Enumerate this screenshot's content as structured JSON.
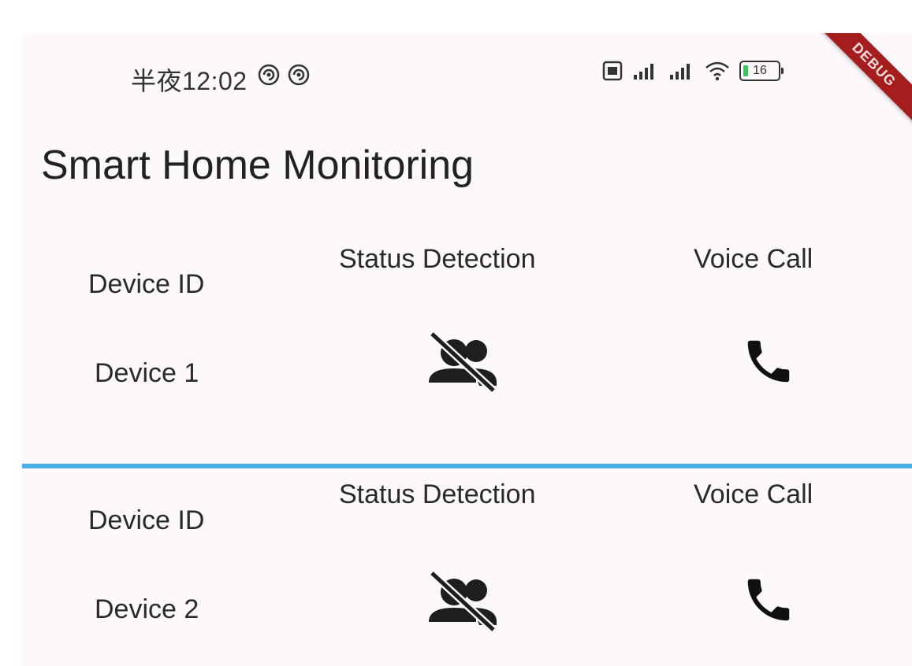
{
  "status_bar": {
    "time": "半夜12:02",
    "battery_level": "16",
    "debug_banner": "DEBUG"
  },
  "app": {
    "title": "Smart Home Monitoring"
  },
  "devices": [
    {
      "id_header": "Device ID",
      "status_header": "Status Detection",
      "voice_header": "Voice Call",
      "name": "Device 1",
      "status_icon": "person-off-icon",
      "call_icon": "phone-icon"
    },
    {
      "id_header": "Device ID",
      "status_header": "Status Detection",
      "voice_header": "Voice Call",
      "name": "Device 2",
      "status_icon": "person-off-icon",
      "call_icon": "phone-icon"
    }
  ],
  "colors": {
    "background": "#fcf8fc",
    "divider": "#47aee9",
    "debug_banner": "#a51d1d",
    "text": "#2a2a2a"
  }
}
